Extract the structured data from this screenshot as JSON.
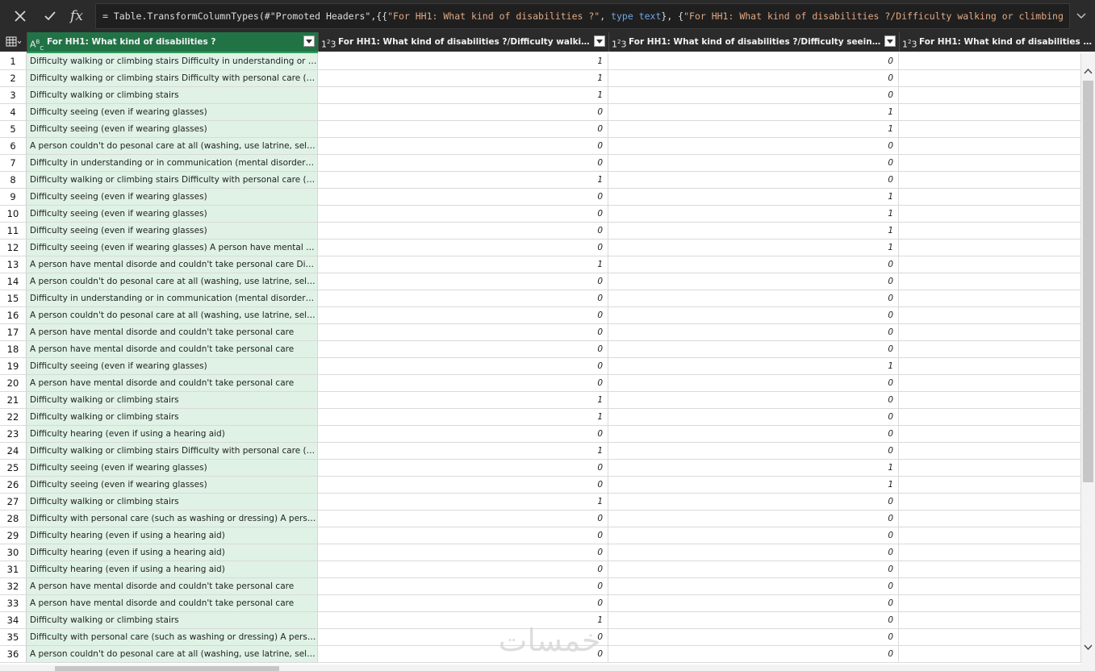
{
  "formula_bar": {
    "cancel_icon": "close-icon",
    "confirm_icon": "check-icon",
    "fx_label": "fx",
    "formula_prefix": "= Table.TransformColumnTypes(#\"Promoted Headers\",{{",
    "formula_str1": "\"For HH1: What kind of disabilities ?\"",
    "formula_sep1": ", ",
    "formula_type1": "type text",
    "formula_sep2": "}, {",
    "formula_str2": "\"For HH1: What kind of disabilities ?/Difficulty walking or climbing stairs\"",
    "formula_tail": ",",
    "expand_icon": "chevron-down-icon"
  },
  "header": {
    "table_icon": "table-icon",
    "columns": [
      {
        "type": "ABC",
        "label": "For HH1: What kind of disabilities ?"
      },
      {
        "type": "123",
        "label": "For HH1: What kind of disabilities ?/Difficulty walking or climbing stairs"
      },
      {
        "type": "123",
        "label": "For HH1: What kind of disabilities ?/Difficulty seeing (even if wearing glasses)"
      },
      {
        "type": "123",
        "label": "For HH1: What kind of disabilities ?/A person"
      }
    ]
  },
  "rows": [
    {
      "n": "1",
      "text": "Difficulty walking or climbing stairs Difficulty in understanding or in communication (mental disorder)",
      "walk": "1",
      "see": "0"
    },
    {
      "n": "2",
      "text": "Difficulty walking or climbing stairs Difficulty with personal care (such as washing or dressing)",
      "walk": "1",
      "see": "0"
    },
    {
      "n": "3",
      "text": "Difficulty walking or climbing stairs",
      "walk": "1",
      "see": "0"
    },
    {
      "n": "4",
      "text": "Difficulty seeing (even if wearing glasses)",
      "walk": "0",
      "see": "1"
    },
    {
      "n": "5",
      "text": "Difficulty seeing (even if wearing glasses)",
      "walk": "0",
      "see": "1"
    },
    {
      "n": "6",
      "text": "A person couldn't do pesonal care at all (washing, use latrine, selfcare)",
      "walk": "0",
      "see": "0"
    },
    {
      "n": "7",
      "text": "Difficulty in understanding or in communication (mental disorder) A person have mental disorde",
      "walk": "0",
      "see": "0"
    },
    {
      "n": "8",
      "text": "Difficulty walking or climbing stairs Difficulty with personal care (such as washing or dressing)",
      "walk": "1",
      "see": "0"
    },
    {
      "n": "9",
      "text": "Difficulty seeing (even if wearing glasses)",
      "walk": "0",
      "see": "1"
    },
    {
      "n": "10",
      "text": "Difficulty seeing (even if wearing glasses)",
      "walk": "0",
      "see": "1"
    },
    {
      "n": "11",
      "text": "Difficulty seeing (even if wearing glasses)",
      "walk": "0",
      "see": "1"
    },
    {
      "n": "12",
      "text": "Difficulty seeing (even if wearing glasses) A person have mental disorde and couldn't take personal care",
      "walk": "0",
      "see": "1"
    },
    {
      "n": "13",
      "text": "A person have mental disorde and couldn't take personal care Difficulty walking or climbing stairs",
      "walk": "1",
      "see": "0"
    },
    {
      "n": "14",
      "text": "A person couldn't do pesonal care at all (washing, use latrine, selfcare)",
      "walk": "0",
      "see": "0"
    },
    {
      "n": "15",
      "text": "Difficulty in understanding or in communication (mental disorder) A person have mental disorde",
      "walk": "0",
      "see": "0"
    },
    {
      "n": "16",
      "text": "A person couldn't do pesonal care at all (washing, use latrine, selfcare)",
      "walk": "0",
      "see": "0"
    },
    {
      "n": "17",
      "text": "A person have mental disorde and couldn't take personal care",
      "walk": "0",
      "see": "0"
    },
    {
      "n": "18",
      "text": "A person have mental disorde and couldn't take personal care",
      "walk": "0",
      "see": "0"
    },
    {
      "n": "19",
      "text": "Difficulty seeing (even if wearing glasses)",
      "walk": "0",
      "see": "1"
    },
    {
      "n": "20",
      "text": "A person have mental disorde and couldn't take personal care",
      "walk": "0",
      "see": "0"
    },
    {
      "n": "21",
      "text": "Difficulty walking or climbing stairs",
      "walk": "1",
      "see": "0"
    },
    {
      "n": "22",
      "text": "Difficulty walking or climbing stairs",
      "walk": "1",
      "see": "0"
    },
    {
      "n": "23",
      "text": "Difficulty hearing (even if using a hearing aid)",
      "walk": "0",
      "see": "0"
    },
    {
      "n": "24",
      "text": "Difficulty walking or climbing stairs Difficulty with personal care (such as washing or dressing)",
      "walk": "1",
      "see": "0"
    },
    {
      "n": "25",
      "text": "Difficulty seeing (even if wearing glasses)",
      "walk": "0",
      "see": "1"
    },
    {
      "n": "26",
      "text": "Difficulty seeing (even if wearing glasses)",
      "walk": "0",
      "see": "1"
    },
    {
      "n": "27",
      "text": "Difficulty walking or climbing stairs",
      "walk": "1",
      "see": "0"
    },
    {
      "n": "28",
      "text": "Difficulty with personal care (such as washing or dressing) A person have mental disorde",
      "walk": "0",
      "see": "0"
    },
    {
      "n": "29",
      "text": "Difficulty hearing (even if using a hearing aid)",
      "walk": "0",
      "see": "0"
    },
    {
      "n": "30",
      "text": "Difficulty hearing (even if using a hearing aid)",
      "walk": "0",
      "see": "0"
    },
    {
      "n": "31",
      "text": "Difficulty hearing (even if using a hearing aid)",
      "walk": "0",
      "see": "0"
    },
    {
      "n": "32",
      "text": "A person have mental disorde and couldn't take personal care",
      "walk": "0",
      "see": "0"
    },
    {
      "n": "33",
      "text": "A person have mental disorde and couldn't take personal care",
      "walk": "0",
      "see": "0"
    },
    {
      "n": "34",
      "text": "Difficulty walking or climbing stairs",
      "walk": "1",
      "see": "0"
    },
    {
      "n": "35",
      "text": "Difficulty with personal care (such as washing or dressing) A person couldn't do pesonal care at all",
      "walk": "0",
      "see": "0"
    },
    {
      "n": "36",
      "text": "A person couldn't do pesonal care at all (washing, use latrine, selfcare)",
      "walk": "0",
      "see": "0"
    }
  ],
  "watermark": "خمسات",
  "colors": {
    "selected_header": "#217346",
    "selected_column_fill": "#dff2e5",
    "dark_bar": "#2b2b2b"
  }
}
